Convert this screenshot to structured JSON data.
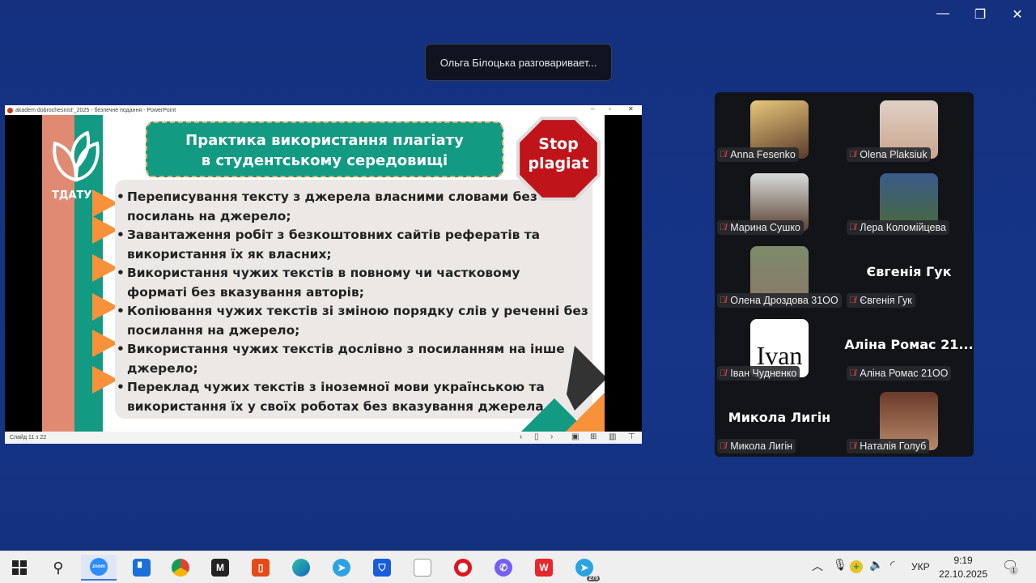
{
  "window": {
    "minimize": "—",
    "restore": "❐",
    "close": "✕"
  },
  "toast": "Ольга Білоцька разговаривает...",
  "powerpoint": {
    "title": "akadem dobrochesnist'_2025  -  безпечне подання - PowerPoint",
    "status": "Слайд 11 з 22",
    "slide": {
      "logo_text": "ТДАТУ",
      "title_lines": [
        "Практика використання плагіату",
        "в студентському середовищі"
      ],
      "stop_lines": [
        "Stop",
        "plagiat"
      ],
      "bullets": [
        {
          "lines": [
            " Переписування тексту з джерела власними словами без",
            "посилань на джерело;"
          ]
        },
        {
          "lines": [
            " Завантаження робіт з безкоштовних сайтів рефератів та",
            "використання їх як власних;"
          ]
        },
        {
          "lines": [
            "Використання чужих текстів в повному чи частковому",
            "форматі без вказування авторів;"
          ]
        },
        {
          "lines": [
            "Копіювання чужих текстів зі зміною порядку слів у реченні без",
            "посилання на джерело;"
          ]
        },
        {
          "lines": [
            "Використання чужих текстів дослівно з посиланням на інше",
            "джерело;"
          ]
        },
        {
          "lines": [
            "Переклад чужих текстів з іноземної мови українською та",
            "використання їх у своїх роботах без вказування джерела"
          ]
        }
      ]
    }
  },
  "participants": [
    {
      "name": "Anna Fesenko",
      "color": "#8a6a4a"
    },
    {
      "name": "Olena Plaksiuk",
      "color": "#c9a58f"
    },
    {
      "name": "Марина Сушко",
      "color": "#b8aea6"
    },
    {
      "name": "Лера Коломійцева",
      "color": "#5a6a4a"
    },
    {
      "name": "Олена Дроздова 31ОО",
      "color": "#7d8a6a"
    },
    {
      "name": "Євгенія Гук",
      "big": "Євгенія Гук"
    },
    {
      "name": "Іван Чудненко",
      "avatar_text": "Ivan"
    },
    {
      "name": "Аліна Ромас 21ОО",
      "big": "Аліна Ромас 21..."
    },
    {
      "name": "Микола Лигін",
      "big": "Микола Лигін"
    },
    {
      "name": "Наталія Голуб",
      "color": "#8a5a3a"
    }
  ],
  "taskbar": {
    "apps": [
      "start",
      "search",
      "zoom",
      "planner",
      "chrome",
      "m-app",
      "office",
      "edge",
      "telegram",
      "bitwarden",
      "file",
      "opera",
      "viber",
      "wps",
      "telegram-2"
    ],
    "zoom_label": "zoom",
    "telegram_badge": "275",
    "language": "УКР",
    "time": "9:19",
    "date": "22.10.2025",
    "notifications": "1"
  }
}
